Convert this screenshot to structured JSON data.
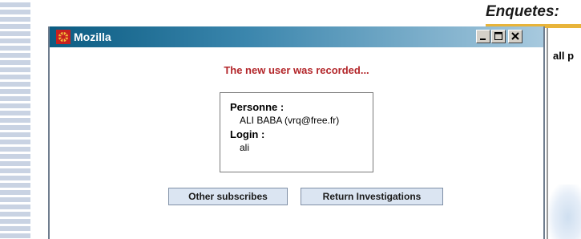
{
  "background_page": {
    "title": "Enquetes:",
    "right_text": "all p"
  },
  "window": {
    "title": "Mozilla",
    "controls": {
      "minimize_icon": "minimize-icon",
      "maximize_icon": "maximize-icon",
      "close_icon": "close-icon"
    }
  },
  "content": {
    "message": "The new user was recorded...",
    "person_label": "Personne :",
    "person_value": "ALI BABA (vrq@free.fr)",
    "login_label": "Login :",
    "login_value": "ali"
  },
  "buttons": {
    "other_label": "Other subscribes",
    "return_label": "Return Investigations"
  },
  "colors": {
    "message": "#b3262a",
    "titlebar_start": "#0b5c82",
    "button_bg": "#dbe5f2",
    "accent_bar": "#e8b43a"
  }
}
